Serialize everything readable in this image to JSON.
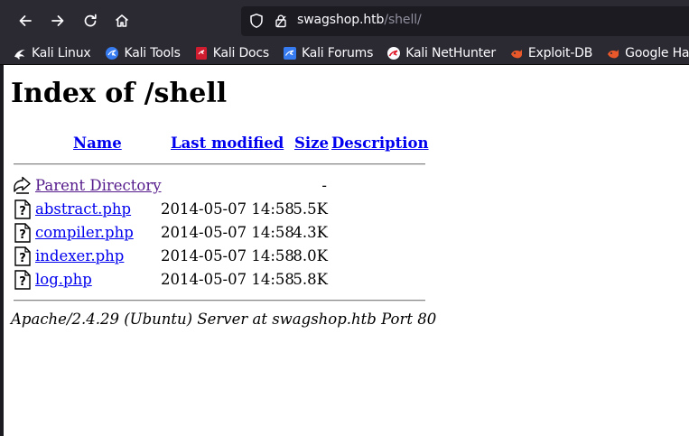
{
  "browser": {
    "url_host": "swagshop.htb",
    "url_path": "/shell/",
    "bookmarks": [
      {
        "label": "Kali Linux",
        "icon": "kali-dragon-icon"
      },
      {
        "label": "Kali Tools",
        "icon": "kali-tools-icon"
      },
      {
        "label": "Kali Docs",
        "icon": "kali-docs-icon"
      },
      {
        "label": "Kali Forums",
        "icon": "kali-forums-icon"
      },
      {
        "label": "Kali NetHunter",
        "icon": "kali-nethunter-icon"
      },
      {
        "label": "Exploit-DB",
        "icon": "exploit-db-icon"
      },
      {
        "label": "Google Hacking",
        "icon": "google-hacking-icon"
      }
    ]
  },
  "page": {
    "title": "Index of /shell",
    "columns": {
      "name": "Name",
      "modified": "Last modified",
      "size": "Size",
      "description": "Description"
    },
    "parent": {
      "name": "Parent Directory",
      "size": "-"
    },
    "files": [
      {
        "name": "abstract.php",
        "modified": "2014-05-07 14:58",
        "size": "5.5K"
      },
      {
        "name": "compiler.php",
        "modified": "2014-05-07 14:58",
        "size": "4.3K"
      },
      {
        "name": "indexer.php",
        "modified": "2014-05-07 14:58",
        "size": "8.0K"
      },
      {
        "name": "log.php",
        "modified": "2014-05-07 14:58",
        "size": "5.8K"
      }
    ],
    "footer": "Apache/2.4.29 (Ubuntu) Server at swagshop.htb Port 80"
  },
  "colors": {
    "chrome_bg": "#2b2a33",
    "link": "#0000ee",
    "visited_link": "#551a8b"
  }
}
